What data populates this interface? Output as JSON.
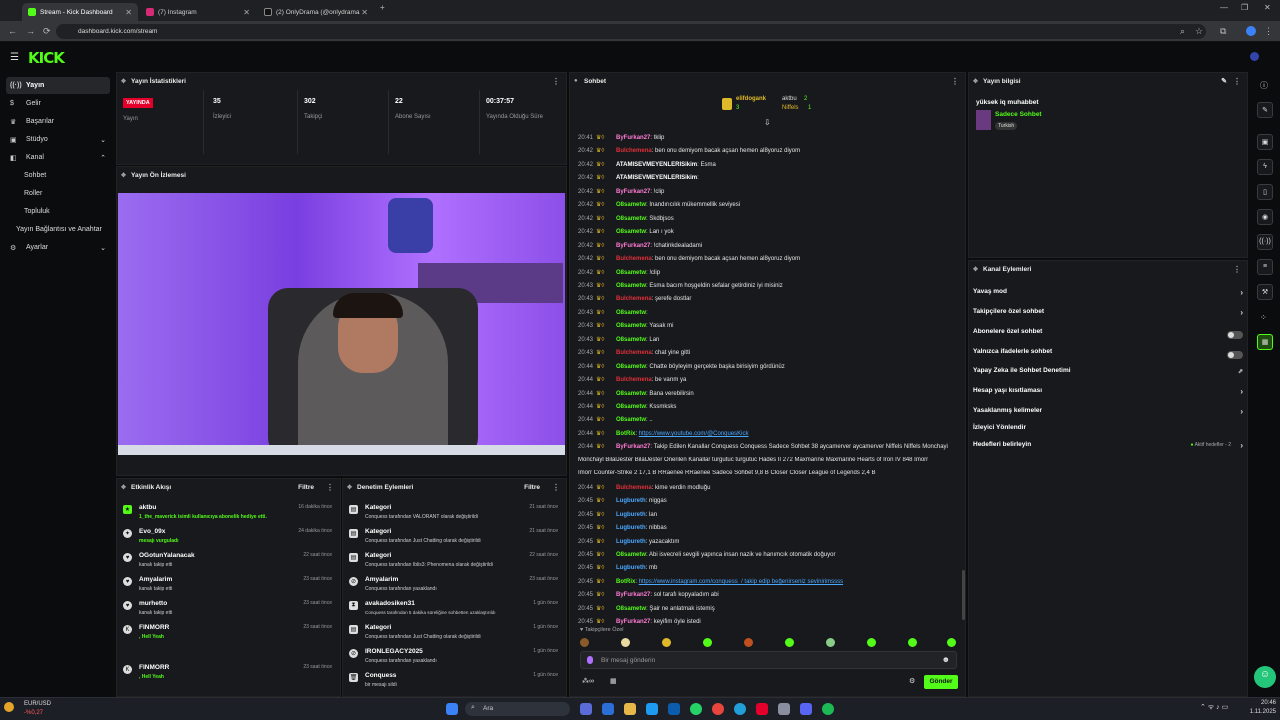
{
  "browser": {
    "tabs": [
      {
        "label": "Stream - Kick Dashboard",
        "color": "#53fc18"
      },
      {
        "label": "(7) Instagram",
        "color": "#d62976"
      },
      {
        "label": "(2) OnlyDrama (@onlydramaX)",
        "color": "#ffffff"
      }
    ],
    "url": "dashboard.kick.com/stream"
  },
  "brand": {
    "logo": "KICK",
    "accent": "#53fc18"
  },
  "sidebar": {
    "items": [
      {
        "label": "Yayın",
        "icon": "radio-icon"
      },
      {
        "label": "Gelir",
        "icon": "dollar-icon"
      },
      {
        "label": "Başarılar",
        "icon": "trophy-icon"
      },
      {
        "label": "Stüdyo",
        "icon": "studio-icon"
      },
      {
        "label": "Kanal",
        "icon": "channel-icon"
      },
      {
        "label": "Sohbet"
      },
      {
        "label": "Roller"
      },
      {
        "label": "Topluluk"
      },
      {
        "label": "Yayın Bağlantısı ve Anahtar"
      },
      {
        "label": "Ayarlar",
        "icon": "gear-icon"
      }
    ]
  },
  "stats": {
    "title": "Yayın İstatistikleri",
    "live_badge": "YAYINDA",
    "live_label": "Yayın",
    "items": [
      {
        "value": "35",
        "label": "İzleyici"
      },
      {
        "value": "302",
        "label": "Takipçi"
      },
      {
        "value": "22",
        "label": "Abone Sayısı"
      },
      {
        "value": "00:37:57",
        "label": "Yayında Olduğu Süre"
      }
    ]
  },
  "preview": {
    "title": "Yayın Ön İzlemesi"
  },
  "activity": {
    "title": "Etkinlik Akışı",
    "filter": "Filtre",
    "items": [
      {
        "name": "aktbu",
        "sub": "1_the_maverick isimli kullanıcıya abonelik hediye etti.",
        "time": "16 dakika önce"
      },
      {
        "name": "Evo_09x",
        "sub": "mesajı vurguladı",
        "time": "24 dakika önce"
      },
      {
        "name": "OGotunYalanacak",
        "sub": "kanalı takip etti",
        "time": "22 saat önce"
      },
      {
        "name": "Amyalarim",
        "sub": "kanalı takip etti",
        "time": "23 saat önce"
      },
      {
        "name": "murhetto",
        "sub": "kanalı takip etti",
        "time": "23 saat önce"
      },
      {
        "name": "FINMORR",
        "sub": ", Hell Yeah",
        "time": "23 saat önce"
      },
      {
        "name": "FINMORR",
        "sub": ", Hell Yeah",
        "time": "23 saat önce"
      }
    ]
  },
  "moderation": {
    "title": "Denetim Eylemleri",
    "filter": "Filtre",
    "items": [
      {
        "name": "Kategori",
        "sub": "Conquess tarafından VALORANT olarak değiştirildi",
        "time": "21 saat önce"
      },
      {
        "name": "Kategori",
        "sub": "Conquess tarafından Just Chatting olarak değiştirildi",
        "time": "21 saat önce"
      },
      {
        "name": "Kategori",
        "sub": "Conquess tarafından Iblis3: Phenomena olarak değiştirildi",
        "time": "22 saat önce"
      },
      {
        "name": "Amyalarim",
        "sub": "Conquess tarafından yasaklandı",
        "time": "23 saat önce"
      },
      {
        "name": "avakadosiken31",
        "sub": "Conquess tarafından 5 dakika süreliğine sohbetten uzaklaştırıldı",
        "time": "1 gün önce"
      },
      {
        "name": "Kategori",
        "sub": "Conquess tarafından Just Chatting olarak değiştirildi",
        "time": "1 gün önce"
      },
      {
        "name": "IRONLEGACY2025",
        "sub": "Conquess tarafından yasaklandı",
        "time": "1 gün önce"
      },
      {
        "name": "Conquess",
        "sub": "bir mesajı sildi",
        "time": "1 gün önce"
      }
    ]
  },
  "chat": {
    "title": "Sohbet",
    "top_users": [
      {
        "name": "elifdogank",
        "count": "3"
      },
      {
        "name": "aktbu",
        "count": "2"
      },
      {
        "name": "Niffels",
        "count": "1"
      }
    ],
    "messages": [
      {
        "t": "20:41",
        "u": "ByFurkan27",
        "c": "#ff7bd5",
        "m": "tklip"
      },
      {
        "t": "20:42",
        "u": "Bulchemena",
        "c": "#e0303a",
        "m": "ben onu demiyom bacak açsan hemen al8yoruz diyom"
      },
      {
        "t": "20:42",
        "u": "ATAMISEVMEYENLERISikim",
        "c": "#ffffff",
        "m": "Esma"
      },
      {
        "t": "20:42",
        "u": "ATAMISEVMEYENLERISikim",
        "c": "#ffffff",
        "m": ""
      },
      {
        "t": "20:42",
        "u": "ByFurkan27",
        "c": "#ff7bd5",
        "m": "!clip"
      },
      {
        "t": "20:42",
        "u": "O8sametw",
        "c": "#53fc18",
        "m": "İnandırıcılık mükemmellik seviyesi"
      },
      {
        "t": "20:42",
        "u": "O8sametw",
        "c": "#53fc18",
        "m": "Skdbjsos"
      },
      {
        "t": "20:42",
        "u": "O8sametw",
        "c": "#53fc18",
        "m": "Lan ı yok"
      },
      {
        "t": "20:42",
        "u": "ByFurkan27",
        "c": "#ff7bd5",
        "m": "!chatinkdealadami"
      },
      {
        "t": "20:42",
        "u": "Bulchemena",
        "c": "#e0303a",
        "m": "ben onu demiyom bacak açsan hemen al8yoruz diyom"
      },
      {
        "t": "20:42",
        "u": "O8sametw",
        "c": "#53fc18",
        "m": "!clip"
      },
      {
        "t": "20:43",
        "u": "O8sametw",
        "c": "#53fc18",
        "m": "Esma bacım hoşgeldin sefalar getirdiniz iyi misiniz"
      },
      {
        "t": "20:43",
        "u": "Bulchemena",
        "c": "#e0303a",
        "m": "şerefe dostlar"
      },
      {
        "t": "20:43",
        "u": "O8sametw",
        "c": "#53fc18",
        "m": ""
      },
      {
        "t": "20:43",
        "u": "O8sametw",
        "c": "#53fc18",
        "m": "Yasak mi"
      },
      {
        "t": "20:43",
        "u": "O8sametw",
        "c": "#53fc18",
        "m": "Lan"
      },
      {
        "t": "20:43",
        "u": "Bulchemena",
        "c": "#e0303a",
        "m": "chat yine gitti"
      },
      {
        "t": "20:44",
        "u": "O8sametw",
        "c": "#53fc18",
        "m": "Chatte böyleyim gerçekte başka birisiyim gördünüz"
      },
      {
        "t": "20:44",
        "u": "Bulchemena",
        "c": "#e0303a",
        "m": "be varım ya"
      },
      {
        "t": "20:44",
        "u": "O8sametw",
        "c": "#53fc18",
        "m": "Bana verebilirsin"
      },
      {
        "t": "20:44",
        "u": "O8sametw",
        "c": "#53fc18",
        "m": "Kssmksks"
      },
      {
        "t": "20:44",
        "u": "O8sametw",
        "c": "#53fc18",
        "m": ".."
      },
      {
        "t": "20:44",
        "u": "BotRix",
        "c": "#53fc18",
        "m": "https://www.youtube.com/@ConquesKick"
      },
      {
        "t": "20:44",
        "u": "ByFurkan27",
        "c": "#ff7bd5",
        "m": "Takip Edilen Kanallar Conquess Conquess Sadece Sohbet 38 aycamerver aycamerver Niffels Niffels Monchayi"
      },
      {
        "t": "",
        "u": "",
        "c": "#ffffff",
        "m": "Monchayl BilalJester BilalJester Önerilen Kanallar turgutuc turgutuc Hades II 272 Maxmarine Maxmarine Hearts of Iron IV 848 Imorr"
      },
      {
        "t": "",
        "u": "",
        "c": "#ffffff",
        "m": "Imorr Counter-Strike 2 17,1 B RRaenee RRaenee Sadece Sohbet 9,8 B Closer Closer League of Legends 2,4 B"
      },
      {
        "t": "20:44",
        "u": "Bulchemena",
        "c": "#e0303a",
        "m": "kime verdin modluğu"
      },
      {
        "t": "20:45",
        "u": "Lugbureth",
        "c": "#4aa8ff",
        "m": "niggas"
      },
      {
        "t": "20:45",
        "u": "Lugbureth",
        "c": "#4aa8ff",
        "m": "lan"
      },
      {
        "t": "20:45",
        "u": "Lugbureth",
        "c": "#4aa8ff",
        "m": "nibbas"
      },
      {
        "t": "20:45",
        "u": "Lugbureth",
        "c": "#4aa8ff",
        "m": "yazacaktım"
      },
      {
        "t": "20:45",
        "u": "O8sametw",
        "c": "#53fc18",
        "m": "Abi isvecreli sevgili yapınca insan nazik ve hanımcık otomatik doğuyor"
      },
      {
        "t": "20:45",
        "u": "Lugbureth",
        "c": "#4aa8ff",
        "m": "mb"
      },
      {
        "t": "20:45",
        "u": "BotRix",
        "c": "#53fc18",
        "m": "https://www.instagram.com/conquess_/ takip edip beğenirseniz sevinirimssss"
      },
      {
        "t": "20:45",
        "u": "ByFurkan27",
        "c": "#ff7bd5",
        "m": "sol tarafı kopyaladım abi"
      },
      {
        "t": "20:45",
        "u": "O8sametw",
        "c": "#53fc18",
        "m": "Şair ne anlatmak istemiş"
      },
      {
        "t": "20:45",
        "u": "ByFurkan27",
        "c": "#ff7bd5",
        "m": "keyifim öyle istedi"
      }
    ],
    "follower_only": "Takipçilere Özel",
    "placeholder": "Bir mesaj gönderin",
    "send": "Gönder"
  },
  "stream_info": {
    "title": "Yayın bilgisi",
    "stream_title": "yüksek iq muhabbet",
    "category": "Sadece Sohbet",
    "tag": "Turkish"
  },
  "channel_actions": {
    "title": "Kanal Eylemleri",
    "items": [
      {
        "label": "Yavaş mod",
        "control": "arrow"
      },
      {
        "label": "Takipçilere özel sohbet",
        "control": "arrow"
      },
      {
        "label": "Abonelere özel sohbet",
        "control": "toggle"
      },
      {
        "label": "Yalnızca ifadelerle sohbet",
        "control": "toggle"
      },
      {
        "label": "Yapay Zeka ile Sohbet Denetimi",
        "control": "external"
      },
      {
        "label": "Hesap yaşı kısıtlaması",
        "control": "arrow"
      },
      {
        "label": "Yasaklanmış kelimeler",
        "control": "arrow"
      },
      {
        "label": "İzleyici Yönlendir",
        "control": "none"
      },
      {
        "label": "Hedefleri belirleyin",
        "control": "arrow",
        "extra": "Aktif hedefler - 2"
      }
    ]
  },
  "taskbar": {
    "ticker": "EUR/USD",
    "ticker_change": "-%0,27",
    "search": "Ara",
    "time": "20:46",
    "date": "1.11.2025"
  }
}
